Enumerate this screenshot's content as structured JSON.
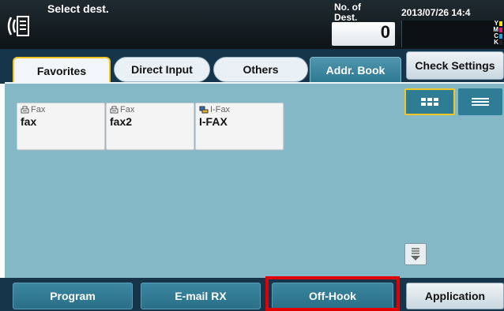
{
  "header": {
    "title": "Select dest.",
    "dest_label": "No. of Dest.",
    "dest_count": "0",
    "datetime": "2013/07/26 14:4",
    "toner_levels": [
      {
        "letter": "Y",
        "color": "#f3e100"
      },
      {
        "letter": "M",
        "color": "#e0197d"
      },
      {
        "letter": "C",
        "color": "#1ea0d8"
      },
      {
        "letter": "K",
        "color": "#222222"
      }
    ]
  },
  "tabs": {
    "favorites": "Favorites",
    "direct_input": "Direct Input",
    "others": "Others",
    "addr_book": "Addr. Book",
    "check_settings": "Check Settings"
  },
  "destinations": [
    {
      "type": "Fax",
      "name": "fax",
      "icon": "fax-icon"
    },
    {
      "type": "Fax",
      "name": "fax2",
      "icon": "fax-icon"
    },
    {
      "type": "I-Fax",
      "name": "I-FAX",
      "icon": "internet-fax-icon"
    }
  ],
  "view_modes": {
    "grid": "grid-view-icon",
    "list": "list-view-icon"
  },
  "bottom": {
    "program": "Program",
    "email_rx": "E-mail RX",
    "off_hook": "Off-Hook",
    "application": "Application"
  },
  "colors": {
    "accent_yellow": "#f2c624",
    "highlight_red": "#e00000",
    "panel_bg": "#84b8c7",
    "button_teal": "#2f7c95"
  }
}
